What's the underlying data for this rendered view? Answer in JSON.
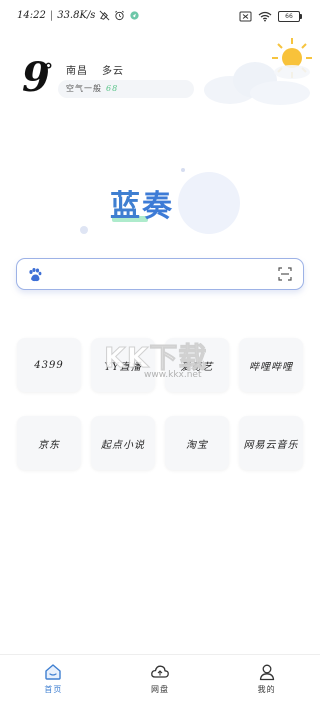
{
  "status_bar": {
    "time": "14:22",
    "network_speed": "33.8K/s",
    "battery_level": "66"
  },
  "weather": {
    "temperature": "9",
    "degree_symbol": "°",
    "city": "南昌",
    "condition": "多云",
    "air_quality_label": "空气一般",
    "air_quality_value": "68",
    "air_quality_color": "#5bc58a"
  },
  "logo": {
    "char1": "蓝",
    "char2": "奏",
    "color": "#3f7fd1"
  },
  "search": {
    "placeholder": "",
    "engine_icon": "baidu-paw-icon",
    "scan_icon": "scan-icon"
  },
  "sites": [
    {
      "label": "4399"
    },
    {
      "label": "YY直播"
    },
    {
      "label": "爱奇艺"
    },
    {
      "label": "哔哩哔哩"
    },
    {
      "label": "京东"
    },
    {
      "label": "起点小说"
    },
    {
      "label": "淘宝"
    },
    {
      "label": "网易云音乐"
    }
  ],
  "watermark": {
    "main": "KK下载",
    "url": "www.kkx.net"
  },
  "bottom_nav": {
    "items": [
      {
        "label": "首页",
        "icon": "home-icon",
        "active": true
      },
      {
        "label": "网盘",
        "icon": "cloud-drive-icon",
        "active": false
      },
      {
        "label": "我的",
        "icon": "profile-icon",
        "active": false
      }
    ],
    "active_color": "#3f7fd1"
  }
}
